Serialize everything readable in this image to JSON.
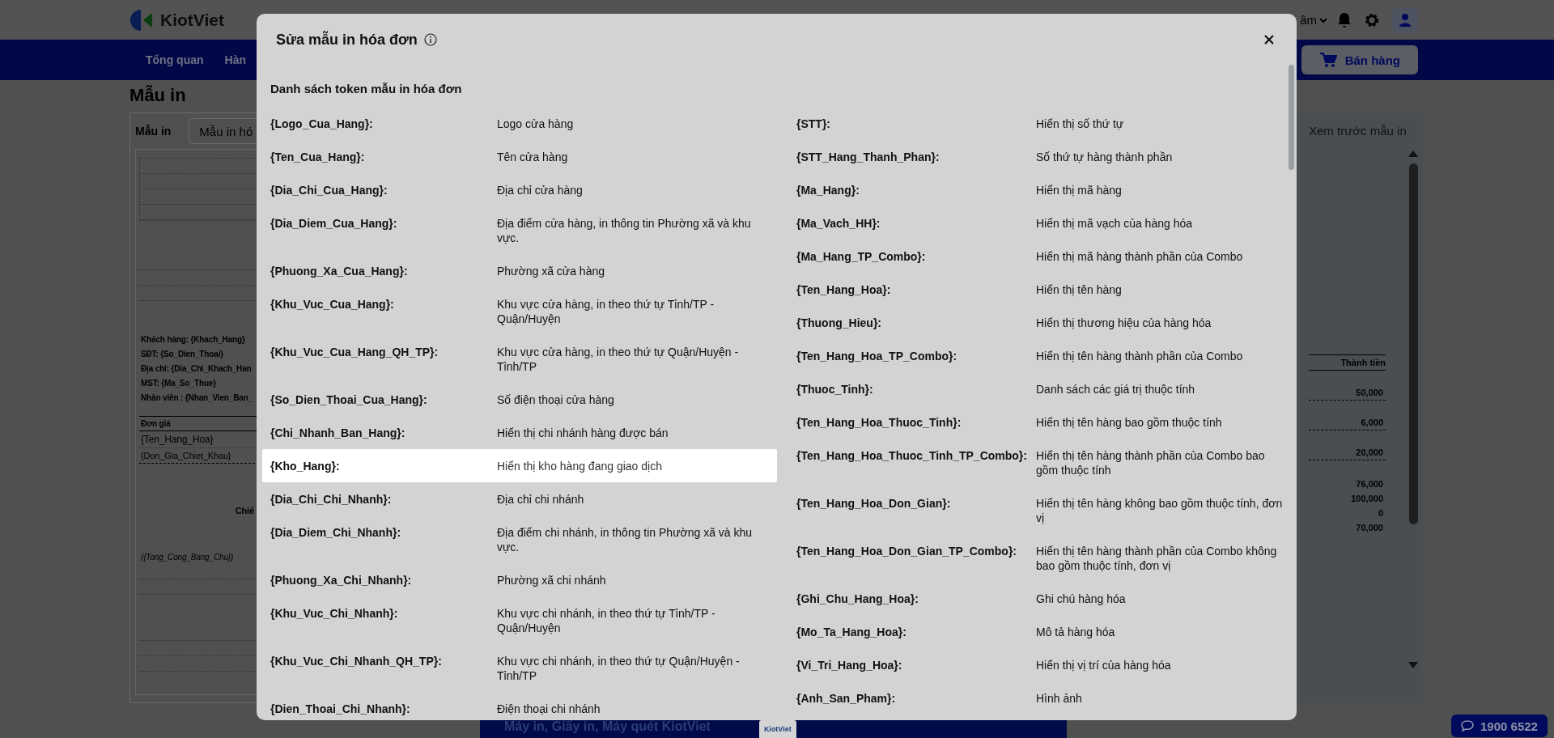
{
  "app_header": {
    "logo_text": "KiotViet",
    "user_menu_text": "âm",
    "nav_items": [
      "Tổng quan",
      "Hàn"
    ],
    "sell_button": "Bán hàng"
  },
  "page": {
    "title": "Mẫu in",
    "template_label": "Mẫu in",
    "template_select": "Mẫu in hó",
    "receipt_lines": [
      {
        "kind": "info",
        "text": "Khách hàng: {Khach_Hang}"
      },
      {
        "kind": "info",
        "text": "SĐT: {So_Dien_Thoai}"
      },
      {
        "kind": "info",
        "text": "Địa chỉ: {Dia_Chi_Khach_Han"
      },
      {
        "kind": "info",
        "text": "MST: {Ma_So_Thue}"
      },
      {
        "kind": "info",
        "text": "Nhân viên : {Nhan_Vien_Ban_"
      },
      {
        "kind": "header",
        "text": "Đơn giá"
      },
      {
        "kind": "item",
        "text": "{Ten_Hang_Hoa}"
      },
      {
        "kind": "discount",
        "text": "{Don_Gia_Chiet_Khau}"
      },
      {
        "kind": "summary",
        "text": "Chiế"
      },
      {
        "kind": "words",
        "text": "({Tong_Cong_Bang_Chu})"
      }
    ],
    "preview": {
      "title": "Xem trước mẫu in",
      "column_header": "Thành tiền",
      "amounts": [
        {
          "kind": "item",
          "value": "50,000"
        },
        {
          "kind": "item",
          "value": "6,000"
        },
        {
          "kind": "item",
          "value": "20,000"
        },
        {
          "kind": "total",
          "value": "76,000"
        },
        {
          "kind": "total",
          "value": "100,000"
        },
        {
          "kind": "total",
          "value": "0"
        },
        {
          "kind": "total",
          "value": "70,000"
        }
      ]
    }
  },
  "modal": {
    "title": "Sửa mẫu in hóa đơn",
    "section_title": "Danh sách token mẫu in hóa đơn",
    "left_tokens": [
      {
        "token": "{Logo_Cua_Hang}:",
        "description": "Logo cửa hàng",
        "highlighted": false
      },
      {
        "token": "{Ten_Cua_Hang}:",
        "description": "Tên cửa hàng",
        "highlighted": false
      },
      {
        "token": "{Dia_Chi_Cua_Hang}:",
        "description": "Địa chỉ cửa hàng",
        "highlighted": false
      },
      {
        "token": "{Dia_Diem_Cua_Hang}:",
        "description": "Địa điểm cửa hàng, in thông tin Phường xã và khu vực.",
        "highlighted": false
      },
      {
        "token": "{Phuong_Xa_Cua_Hang}:",
        "description": "Phường xã cửa hàng",
        "highlighted": false
      },
      {
        "token": "{Khu_Vuc_Cua_Hang}:",
        "description": "Khu vực cửa hàng, in theo thứ tự Tỉnh/TP - Quận/Huyện",
        "highlighted": false
      },
      {
        "token": "{Khu_Vuc_Cua_Hang_QH_TP}:",
        "description": "Khu vực cửa hàng, in theo thứ tự Quận/Huyện - Tỉnh/TP",
        "highlighted": false
      },
      {
        "token": "{So_Dien_Thoai_Cua_Hang}:",
        "description": "Số điện thoại cửa hàng",
        "highlighted": false
      },
      {
        "token": "{Chi_Nhanh_Ban_Hang}:",
        "description": "Hiển thị chi nhánh hàng được bán",
        "highlighted": false
      },
      {
        "token": "{Kho_Hang}:",
        "description": "Hiển thị kho hàng đang giao dịch",
        "highlighted": true
      },
      {
        "token": "{Dia_Chi_Chi_Nhanh}:",
        "description": "Địa chỉ chi nhánh",
        "highlighted": false
      },
      {
        "token": "{Dia_Diem_Chi_Nhanh}:",
        "description": "Địa điểm chi nhánh, in thông tin Phường xã và khu vực.",
        "highlighted": false
      },
      {
        "token": "{Phuong_Xa_Chi_Nhanh}:",
        "description": "Phường xã chi nhánh",
        "highlighted": false
      },
      {
        "token": "{Khu_Vuc_Chi_Nhanh}:",
        "description": "Khu vực chi nhánh, in theo thứ tự Tỉnh/TP - Quận/Huyện",
        "highlighted": false
      },
      {
        "token": "{Khu_Vuc_Chi_Nhanh_QH_TP}:",
        "description": "Khu vực chi nhánh, in theo thứ tự Quận/Huyện - Tỉnh/TP",
        "highlighted": false
      },
      {
        "token": "{Dien_Thoai_Chi_Nhanh}:",
        "description": "Điện thoại chi nhánh",
        "highlighted": false
      }
    ],
    "right_tokens": [
      {
        "token": "{STT}:",
        "description": "Hiển thị số thứ tự",
        "highlighted": false
      },
      {
        "token": "{STT_Hang_Thanh_Phan}:",
        "description": "Số thứ tự hàng thành phần",
        "highlighted": false
      },
      {
        "token": "{Ma_Hang}:",
        "description": "Hiển thị mã hàng",
        "highlighted": false
      },
      {
        "token": "{Ma_Vach_HH}:",
        "description": "Hiển thị mã vạch của hàng hóa",
        "highlighted": false
      },
      {
        "token": "{Ma_Hang_TP_Combo}:",
        "description": "Hiển thị mã hàng thành phần của Combo",
        "highlighted": false
      },
      {
        "token": "{Ten_Hang_Hoa}:",
        "description": "Hiển thị tên hàng",
        "highlighted": false
      },
      {
        "token": "{Thuong_Hieu}:",
        "description": "Hiển thị thương hiệu của hàng hóa",
        "highlighted": false
      },
      {
        "token": "{Ten_Hang_Hoa_TP_Combo}:",
        "description": "Hiển thị tên hàng thành phần của Combo",
        "highlighted": false
      },
      {
        "token": "{Thuoc_Tinh}:",
        "description": "Danh sách các giá trị thuộc tính",
        "highlighted": false
      },
      {
        "token": "{Ten_Hang_Hoa_Thuoc_Tinh}:",
        "description": "Hiển thị tên hàng bao gồm thuộc tính",
        "highlighted": false
      },
      {
        "token": "{Ten_Hang_Hoa_Thuoc_Tinh_TP_Combo}:",
        "description": "Hiển thị tên hàng thành phần của Combo bao gồm thuộc tính",
        "highlighted": false
      },
      {
        "token": "{Ten_Hang_Hoa_Don_Gian}:",
        "description": "Hiển thị tên hàng không bao gồm thuộc tính, đơn vị",
        "highlighted": false
      },
      {
        "token": "{Ten_Hang_Hoa_Don_Gian_TP_Combo}:",
        "description": "Hiển thị tên hàng thành phần của Combo không bao gồm thuộc tính, đơn vị",
        "highlighted": false
      },
      {
        "token": "{Ghi_Chu_Hang_Hoa}:",
        "description": "Ghi chú hàng hóa",
        "highlighted": false
      },
      {
        "token": "{Mo_Ta_Hang_Hoa}:",
        "description": "Mô tả hàng hóa",
        "highlighted": false
      },
      {
        "token": "{Vi_Tri_Hang_Hoa}:",
        "description": "Hiển thị vị trí của hàng hóa",
        "highlighted": false
      },
      {
        "token": "{Anh_San_Pham}:",
        "description": "Hình ảnh",
        "highlighted": false
      }
    ]
  },
  "banner": {
    "text": "Máy in, Giấy in, Máy quét KiotViet",
    "badge": "KiotViet"
  },
  "hotline_button": "1900 6522"
}
